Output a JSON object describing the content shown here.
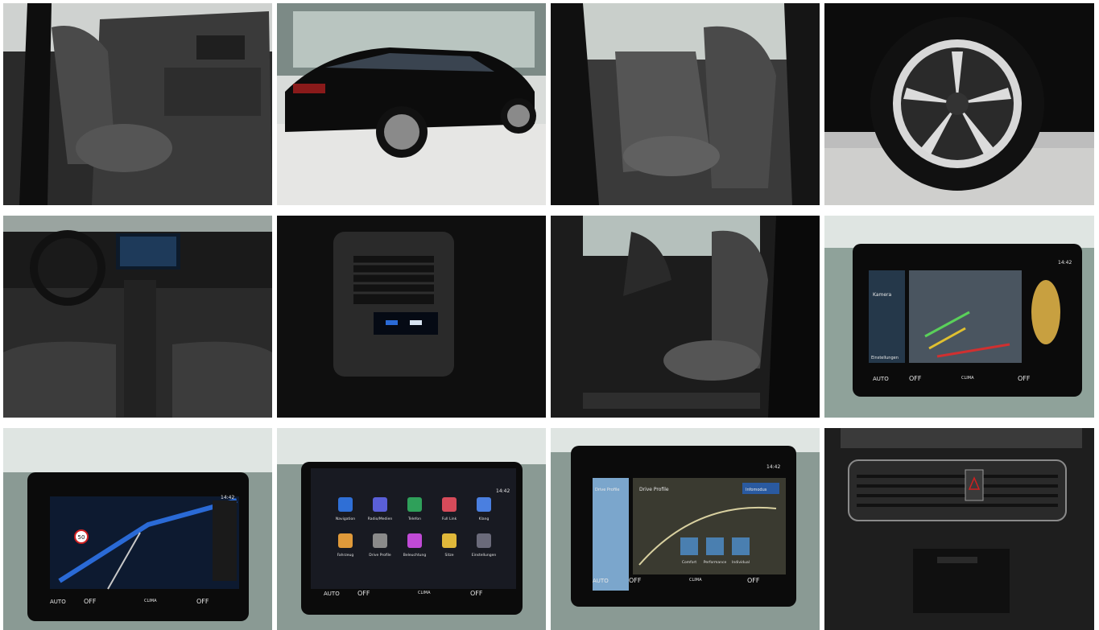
{
  "gallery": {
    "photos": [
      {
        "subject": "driver door open, front seats"
      },
      {
        "subject": "black estate car rear three-quarter in showroom"
      },
      {
        "subject": "rear seats through open door"
      },
      {
        "subject": "alloy wheel close-up"
      },
      {
        "subject": "dashboard and center console from rear"
      },
      {
        "subject": "rear climate vents and display"
      },
      {
        "subject": "front passenger seat, door sill"
      },
      {
        "subject": "infotainment rear camera view"
      },
      {
        "subject": "infotainment navigation map"
      },
      {
        "subject": "infotainment apps menu"
      },
      {
        "subject": "infotainment drive profiles"
      },
      {
        "subject": "center air vents and hazard button"
      }
    ]
  },
  "screens": {
    "camera": {
      "side_label": "Kamera",
      "settings_label": "Einstellungen",
      "time": "14:42",
      "climate": {
        "auto": "AUTO",
        "off_left": "OFF",
        "clima": "CLIMA",
        "off_right": "OFF"
      }
    },
    "navigation": {
      "time": "14:42",
      "speed_limit": "50",
      "climate": {
        "auto": "AUTO",
        "off_left": "OFF",
        "clima": "CLIMA",
        "off_right": "OFF"
      }
    },
    "apps": {
      "time": "14:42",
      "apps": [
        "Navigation",
        "Radio/Medien",
        "Telefon",
        "Full Link",
        "Klang",
        "Fahrzeug",
        "Drive Profile",
        "Beleuchtung",
        "Sitze",
        "Einstellungen"
      ],
      "app_colors": [
        "#2f6fd6",
        "#5a5fd8",
        "#2fa05a",
        "#d64b5a",
        "#4a7fe0",
        "#e09a3a",
        "#8a8a8a",
        "#c04ad6",
        "#e0b83a",
        "#6a6a7a"
      ],
      "climate": {
        "auto": "AUTO",
        "off_left": "OFF",
        "clima": "CLIMA",
        "off_right": "OFF"
      }
    },
    "drive_profile": {
      "title_left": "Drive Profile",
      "title_main": "Drive Profile",
      "time": "14:42",
      "modes": [
        "Comfort",
        "Performance",
        "Individual"
      ],
      "button": "Infomodus",
      "climate": {
        "auto": "AUTO",
        "off_left": "OFF",
        "clima": "CLIMA",
        "off_right": "OFF"
      }
    }
  }
}
